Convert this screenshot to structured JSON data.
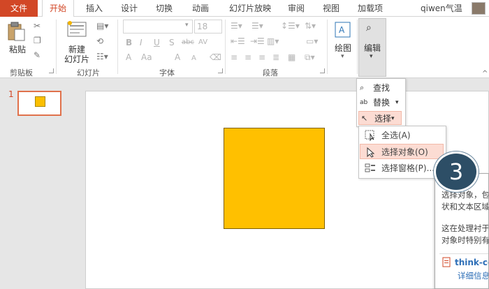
{
  "tabs": [
    "文件",
    "开始",
    "插入",
    "设计",
    "切换",
    "动画",
    "幻灯片放映",
    "审阅",
    "视图",
    "加载项"
  ],
  "user": "qiwen气温",
  "ribbon": {
    "clipboard": {
      "paste": "粘贴",
      "label": "剪贴板"
    },
    "slides": {
      "new_slide_line1": "新建",
      "new_slide_line2": "幻灯片",
      "label": "幻灯片"
    },
    "font": {
      "size": "18",
      "bold": "B",
      "italic": "I",
      "underline": "U",
      "shadow": "S",
      "strike": "abc",
      "spacing": "AV",
      "color": "A",
      "case": "Aa",
      "grow": "A",
      "shrink": "A",
      "label": "字体"
    },
    "paragraph": {
      "label": "段落"
    },
    "drawing": {
      "label": "绘图"
    },
    "editing": {
      "label": "编辑"
    }
  },
  "thumbnail": {
    "number": "1"
  },
  "edit_menu": {
    "find": "查找",
    "replace": "替换",
    "select": "选择"
  },
  "select_submenu": {
    "select_all": "全选(A)",
    "select_objects": "选择对象(O)",
    "selection_pane": "选择窗格(P)..."
  },
  "tooltip": {
    "line1": "选择对象，包",
    "line2": "状和文本区域",
    "line3": "这在处理衬于",
    "line4": "对象时特别有",
    "link": "think-ce",
    "more": "详细信息"
  },
  "badge": "3",
  "colors": {
    "accent": "#d24726",
    "shape_fill": "#ffc000",
    "hover": "#fcdcd3",
    "badge": "#2d4e66"
  }
}
